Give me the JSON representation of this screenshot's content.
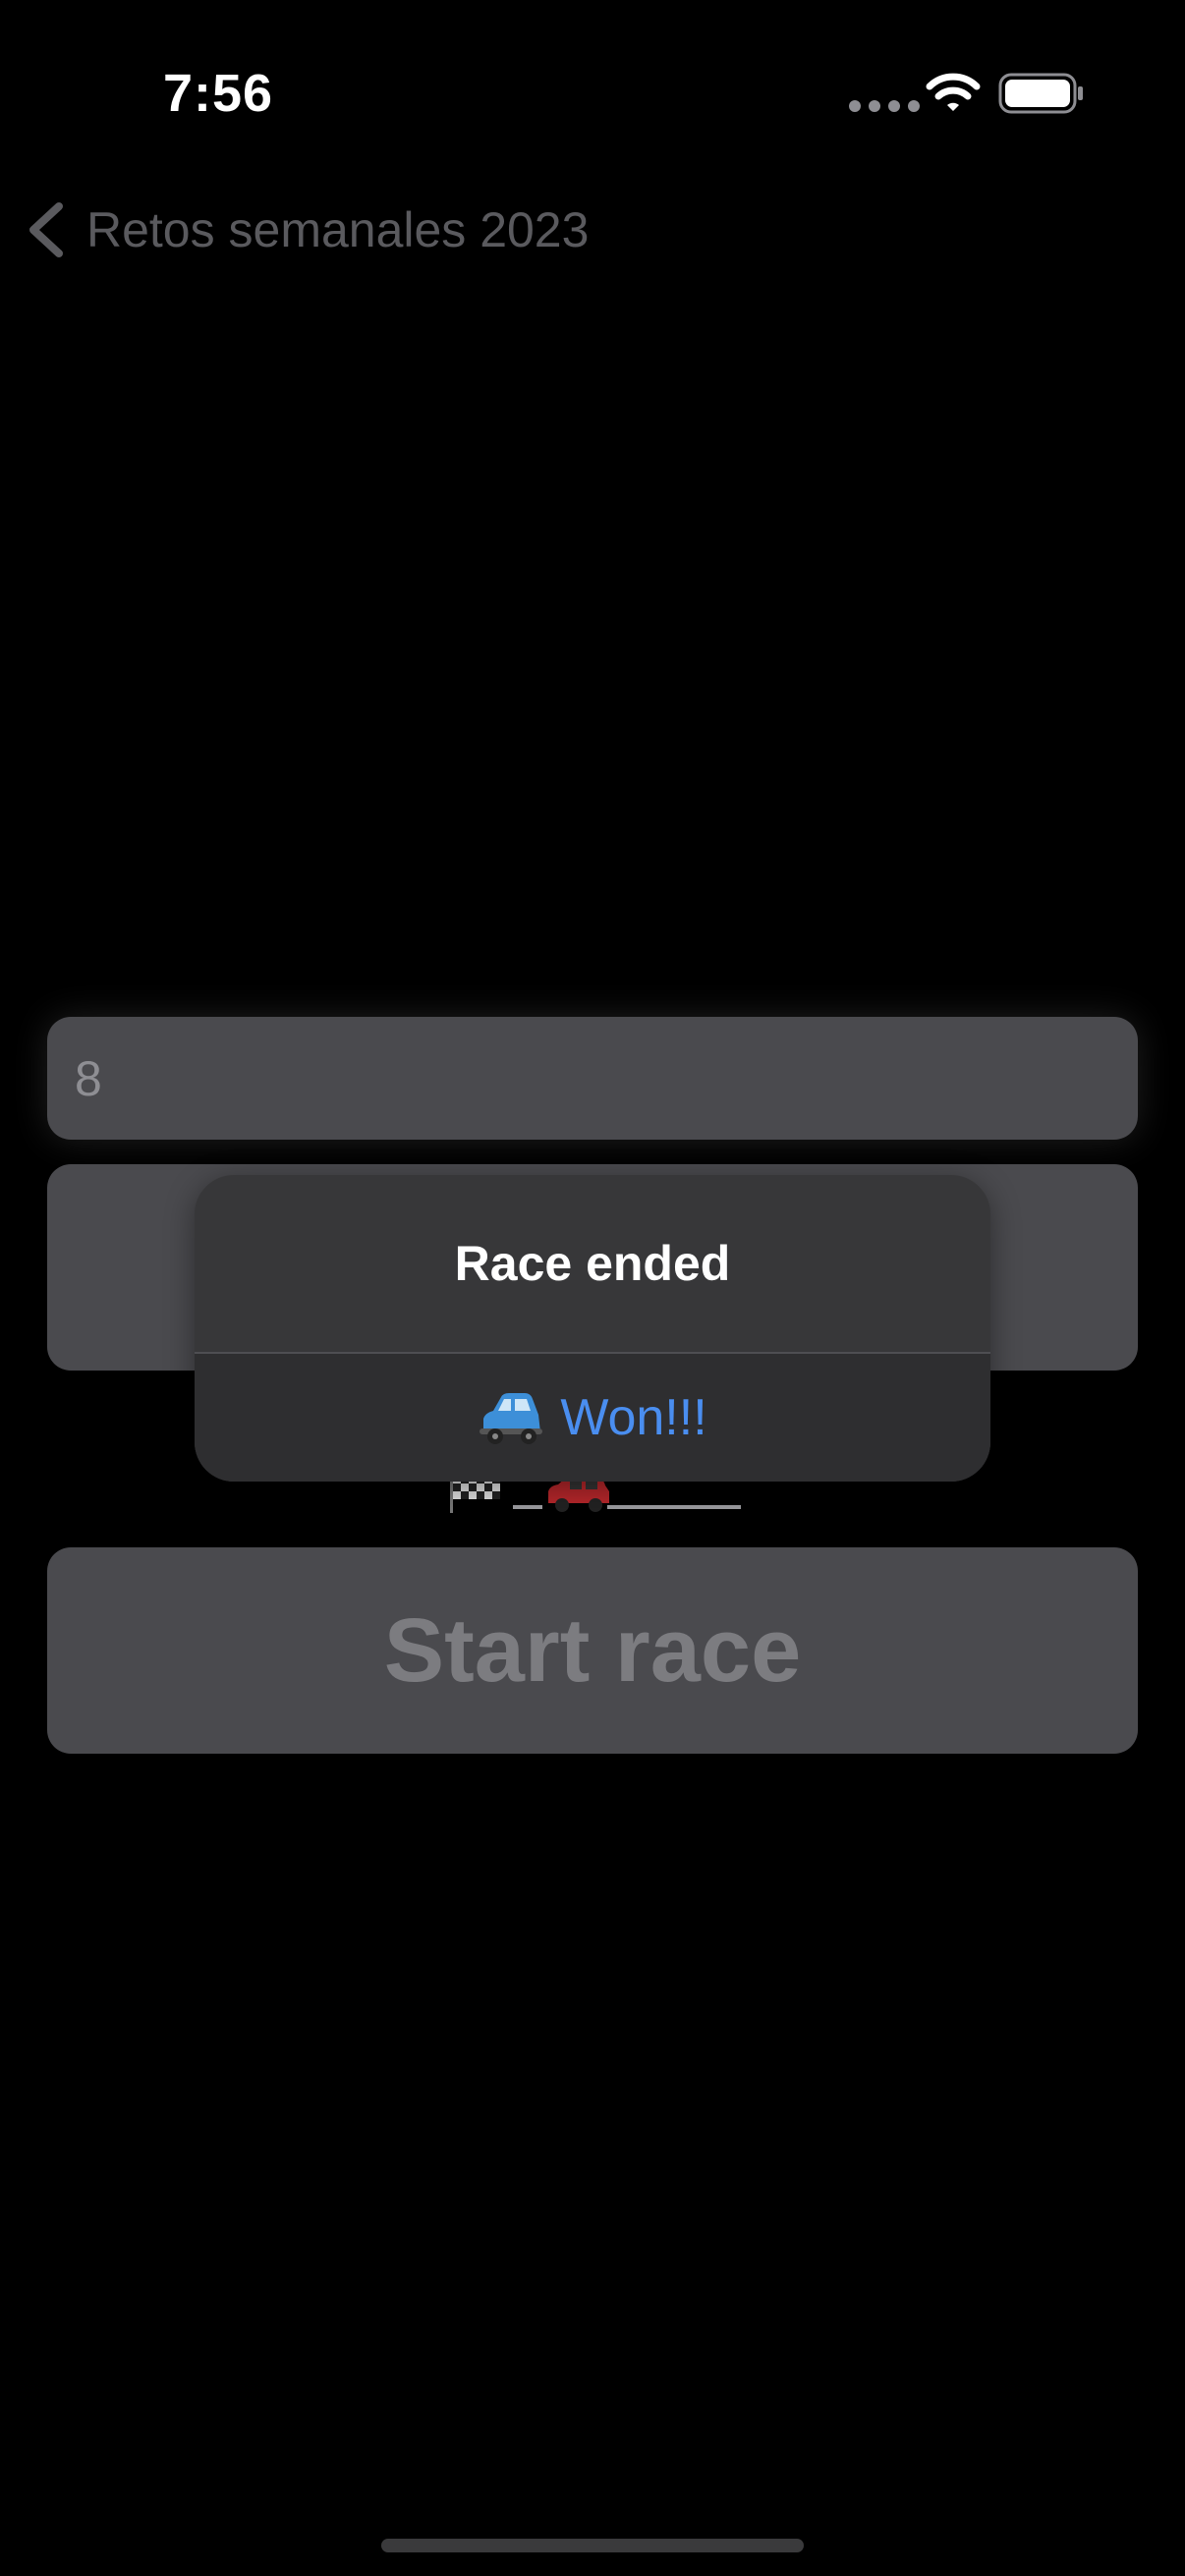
{
  "status_bar": {
    "time": "7:56",
    "icons": [
      "signal-dots-icon",
      "wifi-icon",
      "battery-icon"
    ]
  },
  "nav": {
    "back_label": "Retos semanales 2023",
    "back_icon": "chevron-left-icon"
  },
  "form": {
    "text_field_value": "8"
  },
  "race": {
    "icons": [
      "checkered-flag-icon",
      "red-car-icon"
    ]
  },
  "start_button": {
    "label": "Start race"
  },
  "alert": {
    "title": "Race ended",
    "action_icon": "blue-car-icon",
    "action_label": "Won!!!"
  },
  "colors": {
    "background": "#000000",
    "control": "#4a4a4e",
    "alert_bg": "#373739",
    "accent": "#4a8ef0",
    "disabled_text": "#7c7c80"
  }
}
